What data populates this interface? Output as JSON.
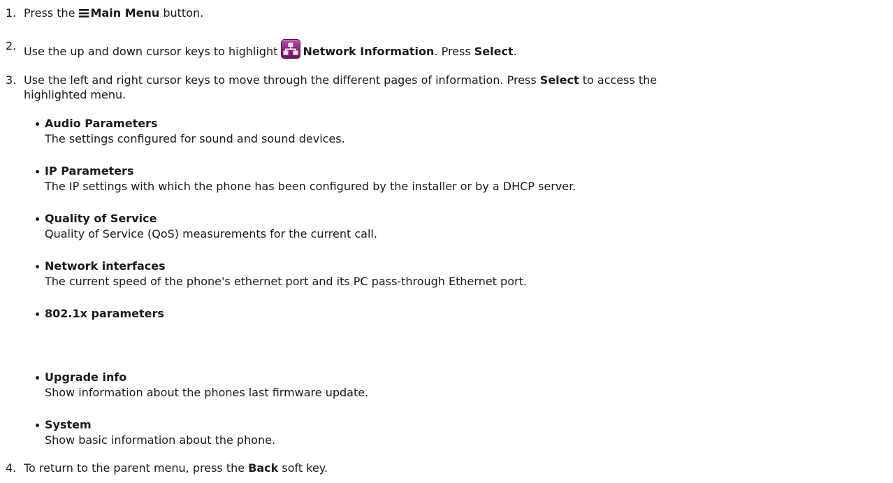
{
  "steps": [
    {
      "num": "1.",
      "before": "Press the",
      "icon": "main-menu-icon",
      "bold": "Main Menu",
      "after": "button."
    },
    {
      "num": "2.",
      "before": "Use the up and down cursor keys to highlight",
      "icon": "network-information-icon",
      "bold": "Network Information",
      "after1": ". Press",
      "bold2": "Select",
      "after2": "."
    },
    {
      "num": "3.",
      "before": "Use the left and right cursor keys to move through the different pages of information. Press",
      "bold": "Select",
      "after_line1": "to access the",
      "line2": "highlighted menu."
    },
    {
      "num": "4.",
      "before": "To return to the parent menu, press the",
      "bold": "Back",
      "after": "soft key."
    }
  ],
  "subitems": [
    {
      "title": "Audio Parameters",
      "desc": "The settings configured for sound and sound devices."
    },
    {
      "title": "IP Parameters",
      "desc": "The IP settings with which the phone has been configured by the installer or by a DHCP server."
    },
    {
      "title": "Quality of Service",
      "desc": "Quality of Service (QoS) measurements for the current call."
    },
    {
      "title": "Network interfaces",
      "desc": "The current speed of the phone's ethernet port and its PC pass-through Ethernet port."
    },
    {
      "title": "802.1x parameters",
      "desc": ""
    },
    {
      "title": "Upgrade info",
      "desc": "Show information about the phones last firmware update."
    },
    {
      "title": "System",
      "desc": "Show basic information about the phone."
    }
  ],
  "colors": {
    "text": "#1a1a1a",
    "network_icon": "#8e1d7c",
    "background": "#ffffff"
  }
}
